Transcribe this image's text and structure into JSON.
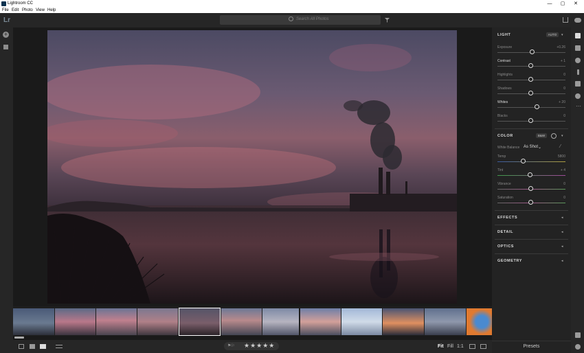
{
  "window": {
    "title": "Lightroom CC",
    "minimize": "—",
    "maximize": "▢",
    "close": "✕"
  },
  "menu": [
    "File",
    "Edit",
    "Photo",
    "View",
    "Help"
  ],
  "topbar": {
    "logo": "Lr",
    "search_placeholder": "Search All Photos"
  },
  "bottombar": {
    "fit": "Fit",
    "fill": "Fill",
    "one_to_one": "1:1",
    "rating": "★★★★★"
  },
  "panel": {
    "light": {
      "title": "LIGHT",
      "auto": "AUTO",
      "caret": "▾",
      "sliders": [
        {
          "label": "Exposure",
          "value": "+0.26",
          "pos": 0.52
        },
        {
          "label": "Contrast",
          "value": "+ 1",
          "pos": 0.5
        },
        {
          "label": "Highlights",
          "value": "0",
          "pos": 0.49
        },
        {
          "label": "Shadows",
          "value": "0",
          "pos": 0.49
        },
        {
          "label": "Whites",
          "value": "+ 20",
          "pos": 0.59
        },
        {
          "label": "Blacks",
          "value": "0",
          "pos": 0.49
        }
      ]
    },
    "color": {
      "title": "COLOR",
      "bw": "B&W",
      "caret": "▾",
      "wb_label": "White Balance",
      "wb_value": "As Shot",
      "sliders": [
        {
          "label": "Temp",
          "value": "5800",
          "pos": 0.38
        },
        {
          "label": "Tint",
          "value": "+ 4",
          "pos": 0.48
        },
        {
          "label": "Vibrance",
          "value": "0",
          "pos": 0.49
        },
        {
          "label": "Saturation",
          "value": "0",
          "pos": 0.49
        }
      ]
    },
    "sections": [
      {
        "title": "EFFECTS"
      },
      {
        "title": "DETAIL"
      },
      {
        "title": "OPTICS"
      },
      {
        "title": "GEOMETRY"
      }
    ],
    "presets": "Presets"
  }
}
